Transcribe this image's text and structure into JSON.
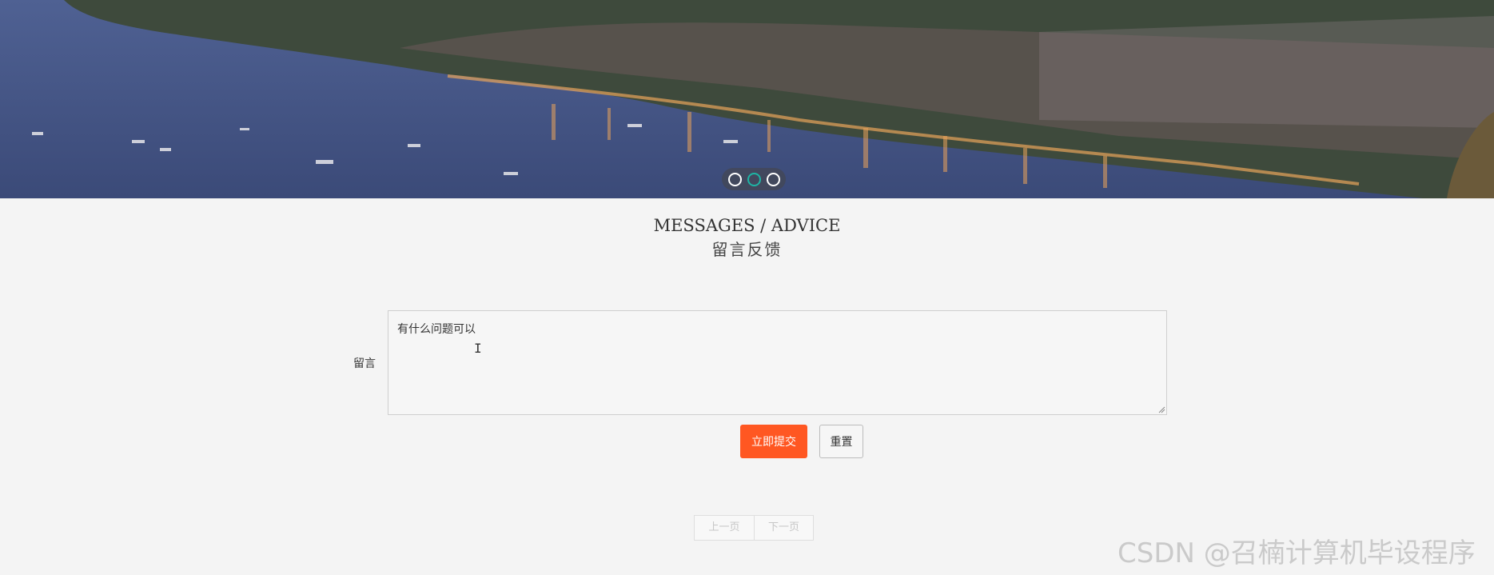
{
  "banner": {
    "alt": "Harbour town at dusk",
    "dots": [
      "slide-1",
      "slide-2",
      "slide-3"
    ],
    "active_dot": 1
  },
  "heading": {
    "english": "MESSAGES / ADVICE",
    "chinese": "留言反馈"
  },
  "form": {
    "label": "留言",
    "message_value": "有什么问题可以",
    "submit_label": "立即提交",
    "reset_label": "重置"
  },
  "pager": {
    "prev_label": "上一页",
    "next_label": "下一页"
  },
  "watermark": "CSDN @召楠计算机毕设程序",
  "colors": {
    "submit": "#ff5722",
    "active_dot": "#1eb4a4",
    "page_bg": "#f4f4f4"
  }
}
